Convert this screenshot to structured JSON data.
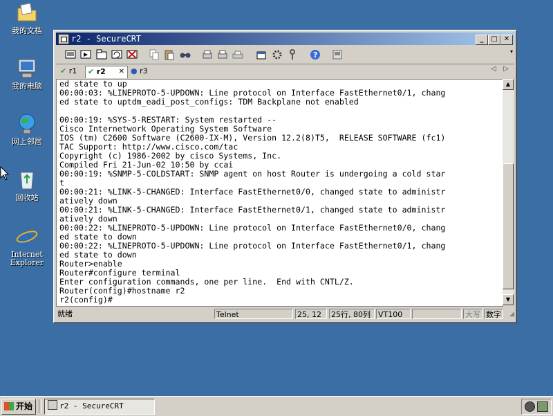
{
  "desktop": {
    "icons": [
      {
        "label": "我的文档"
      },
      {
        "label": "我的电脑"
      },
      {
        "label": "网上邻居"
      },
      {
        "label": "回收站"
      },
      {
        "label": "Internet Explorer"
      }
    ]
  },
  "window": {
    "title": "r2 - SecureCRT",
    "controls": {
      "minimize": "_",
      "maximize": "□",
      "close": "✕"
    }
  },
  "tabs": [
    {
      "label": "r1"
    },
    {
      "label": "r2",
      "close": "✕"
    },
    {
      "label": "r3"
    }
  ],
  "tab_nav": {
    "prev": "◁",
    "next": "▷"
  },
  "terminal": {
    "lines": [
      "ed state to up",
      "00:00:03: %LINEPROTO-5-UPDOWN: Line protocol on Interface FastEthernet0/1, chang",
      "ed state to uptdm_eadi_post_configs: TDM Backplane not enabled",
      "",
      "00:00:19: %SYS-5-RESTART: System restarted --",
      "Cisco Internetwork Operating System Software",
      "IOS (tm) C2600 Software (C2600-IX-M), Version 12.2(8)T5,  RELEASE SOFTWARE (fc1)",
      "TAC Support: http://www.cisco.com/tac",
      "Copyright (c) 1986-2002 by cisco Systems, Inc.",
      "Compiled Fri 21-Jun-02 10:50 by ccai",
      "00:00:19: %SNMP-5-COLDSTART: SNMP agent on host Router is undergoing a cold star",
      "t",
      "00:00:21: %LINK-5-CHANGED: Interface FastEthernet0/0, changed state to administr",
      "atively down",
      "00:00:21: %LINK-5-CHANGED: Interface FastEthernet0/1, changed state to administr",
      "atively down",
      "00:00:22: %LINEPROTO-5-UPDOWN: Line protocol on Interface FastEthernet0/0, chang",
      "ed state to down",
      "00:00:22: %LINEPROTO-5-UPDOWN: Line protocol on Interface FastEthernet0/1, chang",
      "ed state to down",
      "Router>enable",
      "Router#configure terminal",
      "Enter configuration commands, one per line.  End with CNTL/Z.",
      "Router(config)#hostname r2",
      "r2(config)#"
    ]
  },
  "statusbar": {
    "ready": "就绪",
    "protocol": "Telnet",
    "cursor": "25, 12",
    "size": "25行, 80列",
    "emulation": "VT100",
    "caps": "大写",
    "num": "数字"
  },
  "taskbar": {
    "start": "开始",
    "task": "r2 - SecureCRT"
  },
  "colors": {
    "desktop": "#3a6ea5",
    "titlebar_start": "#0a246a",
    "titlebar_end": "#a6caf0"
  }
}
